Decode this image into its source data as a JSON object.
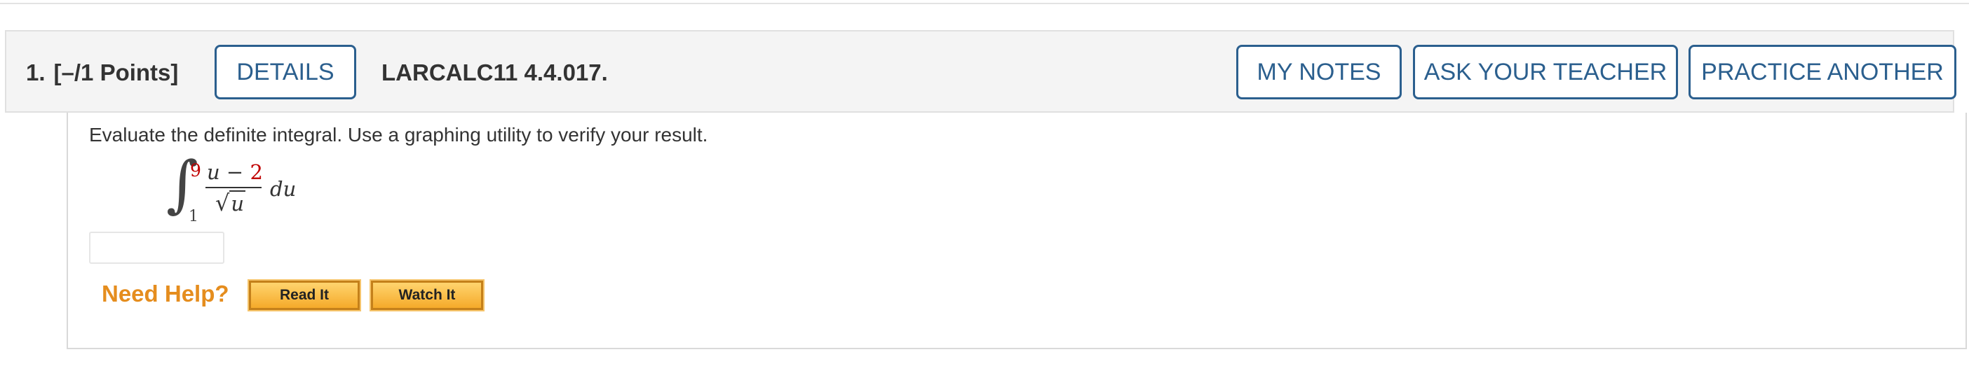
{
  "question": {
    "number": "1.",
    "points": "[–/1 Points]",
    "details_label": "DETAILS",
    "code": "LARCALC11 4.4.017."
  },
  "actions": {
    "my_notes": "MY NOTES",
    "ask_teacher": "ASK YOUR TEACHER",
    "practice_another": "PRACTICE ANOTHER"
  },
  "problem": {
    "prompt": "Evaluate the definite integral. Use a graphing utility to verify your result.",
    "integral_symbol": "∫",
    "upper_limit": "9",
    "lower_limit": "1",
    "numerator_var": "u",
    "numerator_op": "−",
    "numerator_const": "2",
    "radical": "√",
    "denominator_var": "u",
    "differential": "du",
    "answer_value": ""
  },
  "help": {
    "label": "Need Help?",
    "read_it": "Read It",
    "watch_it": "Watch It"
  },
  "colors": {
    "accent_blue": "#2b5f8e",
    "highlight_red": "#c00000",
    "help_orange": "#e58d1e"
  }
}
